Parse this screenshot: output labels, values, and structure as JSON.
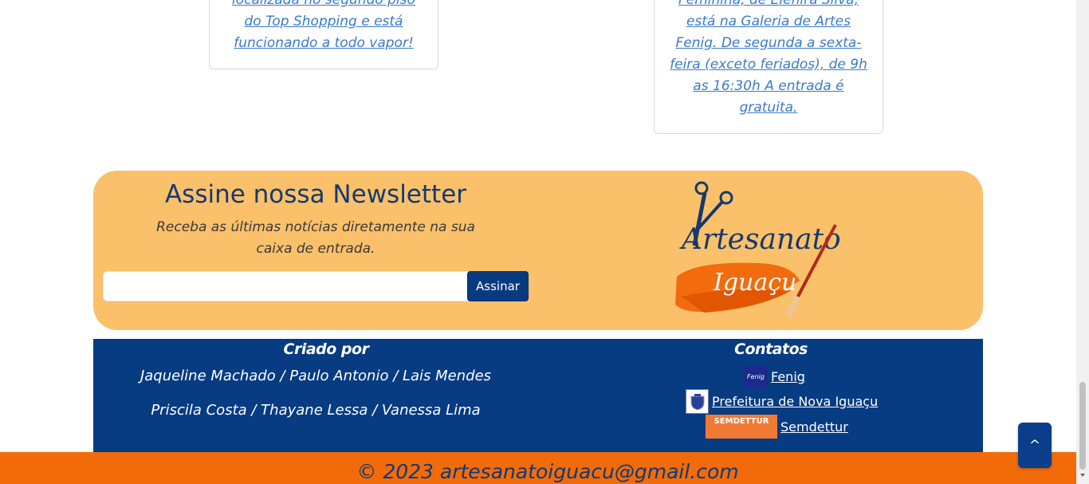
{
  "cards": {
    "left": {
      "lines": [
        "localizada no segundo piso",
        "do Top Shopping e está",
        "funcionando a todo vapor!"
      ]
    },
    "right": {
      "lines": [
        "Feminina, de Elenira Silva,",
        "está na Galeria de Artes",
        "Fenig. De segunda a sexta-",
        "feira (exceto feriados), de 9h",
        "as 16:30h A entrada é",
        "gratuita."
      ]
    }
  },
  "newsletter": {
    "title": "Assine nossa Newsletter",
    "subtitle": "Receba as últimas notícias diretamente na sua caixa de entrada.",
    "input_value": "",
    "button_label": "Assinar",
    "logo": {
      "word1": "Artesanato",
      "word2": "Iguaçu"
    }
  },
  "footer": {
    "created_by_title": "Criado por",
    "names_line1": "Jaqueline Machado / Paulo Antonio / Lais Mendes",
    "names_line2": "Priscila Costa / Thayane Lessa / Vanessa Lima",
    "contacts_title": "Contatos",
    "contacts": [
      {
        "label": "Fenig",
        "logo_text": "Fenig"
      },
      {
        "label": "Prefeitura de Nova Iguaçu"
      },
      {
        "label": "Semdettur",
        "logo_text": "SEMDETTUR"
      }
    ],
    "copyright": "© 2023 artesanatoiguacu@gmail.com"
  },
  "back_to_top": "^",
  "colors": {
    "newsletter_bg": "#fbc06a",
    "footer_bg": "#073b82",
    "bottom_bar_bg": "#f36b09",
    "accent_blue": "#083a80"
  }
}
